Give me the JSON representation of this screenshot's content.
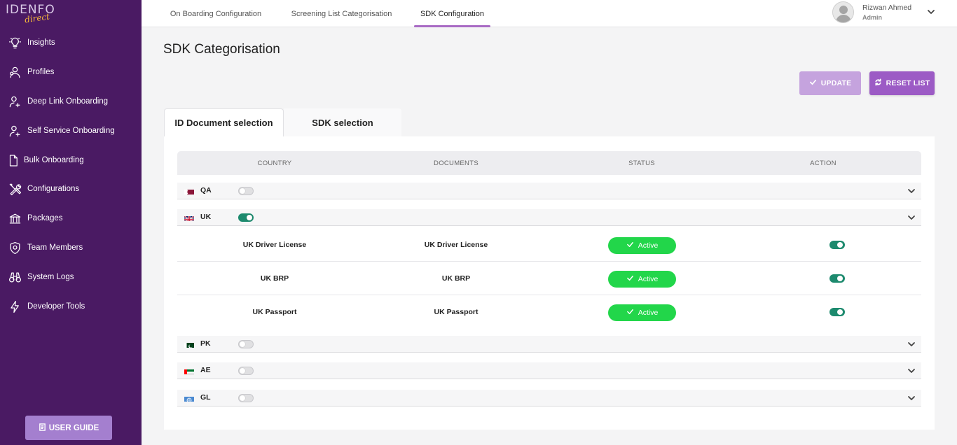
{
  "sidebar": {
    "logo_main": "IDENFO",
    "logo_sub": "direct",
    "items": [
      {
        "label": "Insights",
        "icon": "lightbulb-icon"
      },
      {
        "label": "Profiles",
        "icon": "users-icon"
      },
      {
        "label": "Deep Link Onboarding",
        "icon": "user-plus-icon"
      },
      {
        "label": "Self Service Onboarding",
        "icon": "user-plus-icon"
      },
      {
        "label": "Bulk Onboarding",
        "icon": "document-icon"
      },
      {
        "label": "Configurations",
        "icon": "tools-icon"
      },
      {
        "label": "Packages",
        "icon": "bank-icon"
      },
      {
        "label": "Team Members",
        "icon": "shield-icon"
      },
      {
        "label": "System Logs",
        "icon": "binoculars-icon"
      },
      {
        "label": "Developer Tools",
        "icon": "lightning-icon"
      }
    ],
    "user_guide_label": "USER GUIDE"
  },
  "topbar": {
    "tabs": [
      {
        "label": "On Boarding Configuration",
        "active": false
      },
      {
        "label": "Screening List Categorisation",
        "active": false
      },
      {
        "label": "SDK Configuration",
        "active": true
      }
    ],
    "user": {
      "name": "Rizwan Ahmed",
      "role": "Admin"
    }
  },
  "main": {
    "title": "SDK Categorisation",
    "update_label": "UPDATE",
    "reset_label": "RESET LIST",
    "tabs": [
      {
        "label": "ID Document selection",
        "active": true
      },
      {
        "label": "SDK selection",
        "active": false
      }
    ],
    "columns": [
      "COUNTRY",
      "DOCUMENTS",
      "STATUS",
      "ACTION"
    ],
    "countries": [
      {
        "code": "QA",
        "enabled": false,
        "expanded": false
      },
      {
        "code": "UK",
        "enabled": true,
        "expanded": true
      },
      {
        "code": "PK",
        "enabled": false,
        "expanded": false
      },
      {
        "code": "AE",
        "enabled": false,
        "expanded": false
      },
      {
        "code": "GL",
        "enabled": false,
        "expanded": false
      }
    ],
    "uk_documents": [
      {
        "country_doc": "UK Driver License",
        "document": "UK Driver License",
        "status": "Active",
        "enabled": true
      },
      {
        "country_doc": "UK BRP",
        "document": "UK BRP",
        "status": "Active",
        "enabled": true
      },
      {
        "country_doc": "UK Passport",
        "document": "UK Passport",
        "status": "Active",
        "enabled": true
      }
    ]
  },
  "colors": {
    "sidebar_bg": "#4a1a63",
    "accent": "#9c5bc5",
    "status_active": "#22d64a",
    "toggle_on": "#1d8a6e"
  }
}
